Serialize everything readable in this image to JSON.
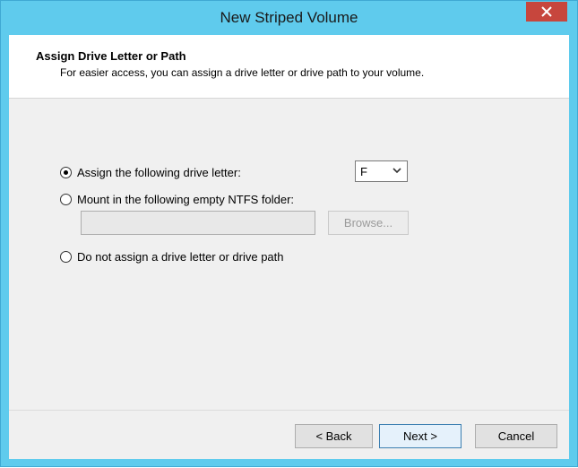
{
  "window": {
    "title": "New Striped Volume",
    "colors": {
      "frame": "#5fcbed",
      "close": "#c7463d"
    }
  },
  "header": {
    "title": "Assign Drive Letter or Path",
    "subtitle": "For easier access, you can assign a drive letter or drive path to your volume."
  },
  "options": {
    "assign_letter": {
      "label": "Assign the following drive letter:",
      "selected": true
    },
    "mount_folder": {
      "label": "Mount in the following empty NTFS folder:",
      "selected": false
    },
    "no_assign": {
      "label": "Do not assign a drive letter or drive path",
      "selected": false
    }
  },
  "drive_letter": {
    "value": "F",
    "icon": "chevron-down-icon"
  },
  "folder_path": {
    "value": "",
    "browse_label": "Browse..."
  },
  "buttons": {
    "back": "< Back",
    "next": "Next >",
    "cancel": "Cancel"
  }
}
